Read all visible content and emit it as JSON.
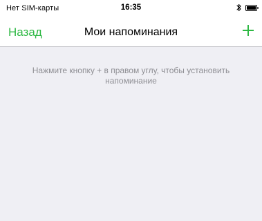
{
  "status_bar": {
    "carrier": "Нет SIM-карты",
    "time": "16:35",
    "icons": [
      "bluetooth-icon",
      "battery-icon"
    ]
  },
  "nav_bar": {
    "back_label": "Назад",
    "title": "Мои напоминания",
    "add_icon": "plus-icon"
  },
  "main": {
    "empty_hint": "Нажмите кнопку + в правом углу, чтобы установить напоминание"
  },
  "colors": {
    "accent": "#2db843",
    "background": "#efeff4",
    "hint_text": "#8e8e93"
  }
}
